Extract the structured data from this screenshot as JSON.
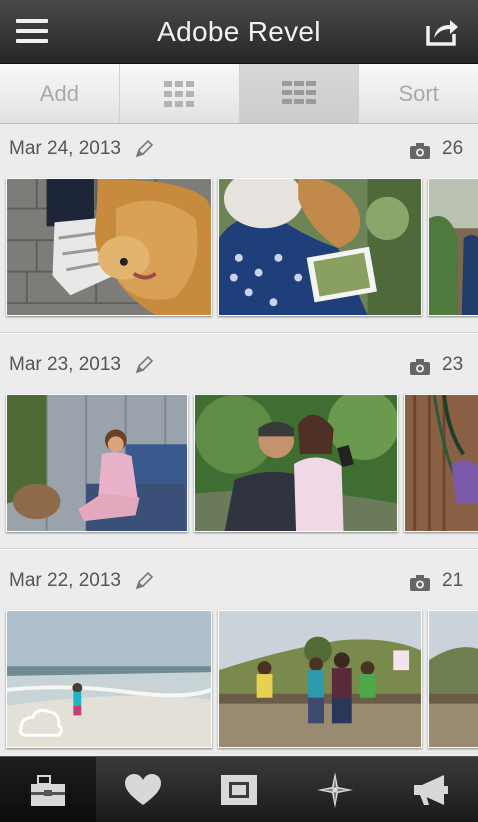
{
  "header": {
    "title": "Adobe Revel",
    "menu_icon": "hamburger-menu-icon",
    "share_icon": "share-icon"
  },
  "toolbar": {
    "add_label": "Add",
    "grid_small_icon": "grid-small-icon",
    "grid_large_icon": "grid-large-icon",
    "sort_label": "Sort",
    "active_index": 2
  },
  "groups": [
    {
      "date": "Mar 24, 2013",
      "count": "26",
      "edit_icon": "pencil-icon",
      "count_icon": "camera-icon"
    },
    {
      "date": "Mar 23, 2013",
      "count": "23",
      "edit_icon": "pencil-icon",
      "count_icon": "camera-icon"
    },
    {
      "date": "Mar 22, 2013",
      "count": "21",
      "edit_icon": "pencil-icon",
      "count_icon": "camera-icon"
    }
  ],
  "tabbar": {
    "tabs": [
      {
        "icon": "library-box-icon",
        "active": true
      },
      {
        "icon": "heart-icon",
        "active": false
      },
      {
        "icon": "album-icon",
        "active": false
      },
      {
        "icon": "compass-icon",
        "active": false
      },
      {
        "icon": "megaphone-icon",
        "active": false
      }
    ]
  },
  "colors": {
    "header_bg": "#2e2e2e",
    "toolbar_bg": "#ececec",
    "content_bg": "#ececec",
    "tabbar_bg": "#222222"
  }
}
